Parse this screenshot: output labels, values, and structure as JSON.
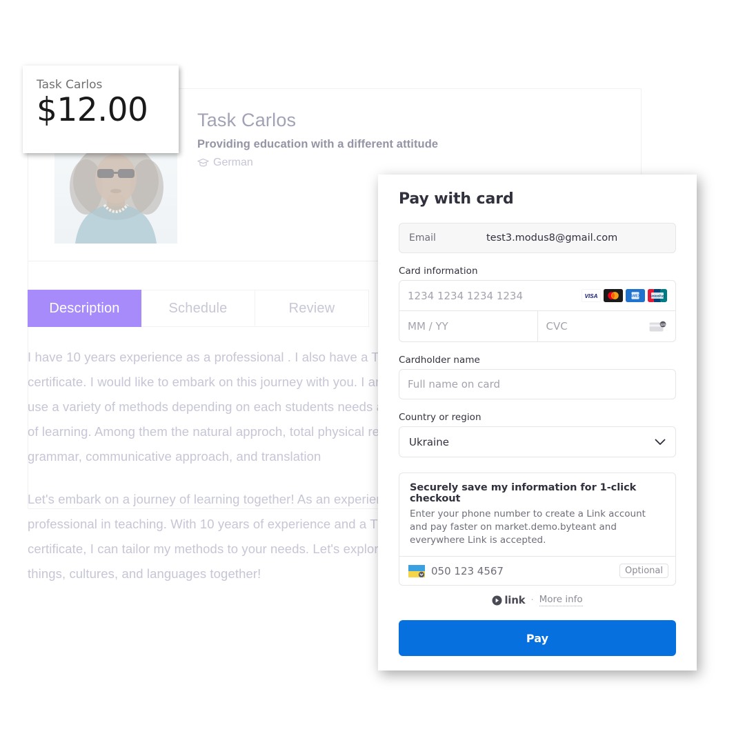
{
  "price_panel": {
    "title": "Task Carlos",
    "amount": "$12.00"
  },
  "profile": {
    "name": "Task Carlos",
    "tagline": "Providing education with a different attitude",
    "subject": "German",
    "subject_icon": "graduation-cap-icon",
    "avatar_alt": "Task Carlos profile photo"
  },
  "tabs": [
    {
      "label": "Description",
      "active": true
    },
    {
      "label": "Schedule",
      "active": false
    },
    {
      "label": "Review",
      "active": false
    }
  ],
  "description": {
    "paragraph_1": "I have 10 years experience as a professional . I also have a TEFL certificate. I would like to embark on this journey with you. I am going to use a variety of methods depending on each students needs and pase of learning. Among them the natural approch, total physical response, grammar, communicative approach, and translation",
    "paragraph_2": "Let's embark on a journey of learning together! As an experienced professional in teaching. With 10 years of experience and a TEFL certificate, I can tailor my methods to your needs. Let's explore new things, cultures, and languages together!"
  },
  "pay_modal": {
    "title": "Pay with card",
    "email": {
      "label": "Email",
      "value": "test3.modus8@gmail.com"
    },
    "card_information": {
      "label": "Card information",
      "number_placeholder": "1234 1234 1234 1234",
      "expiry_placeholder": "MM / YY",
      "cvc_placeholder": "CVC",
      "brands": [
        "visa-icon",
        "mastercard-icon",
        "amex-icon",
        "unionpay-icon"
      ],
      "cvc_hint_icon": "cvc-card-icon"
    },
    "cardholder": {
      "label": "Cardholder name",
      "placeholder": "Full name on card"
    },
    "country": {
      "label": "Country or region",
      "value": "Ukraine",
      "chevron_icon": "chevron-down-icon"
    },
    "link_save": {
      "heading": "Securely save my information for 1-click checkout",
      "description": "Enter your phone number to create a Link account and pay faster on market.demo.byteant and everywhere Link is accepted.",
      "phone_placeholder": "050 123 4567",
      "flag_icon": "ukraine-flag-icon",
      "optional_badge": "Optional"
    },
    "footer": {
      "link_icon": "link-arrow-icon",
      "link_word": "link",
      "separator": "·",
      "more_info": "More info"
    },
    "pay_button": "Pay"
  },
  "colors": {
    "tab_active": "#a78bfa",
    "pay_button": "#0570de",
    "modal_text": "#30313d",
    "muted_text": "#6d6e78"
  }
}
